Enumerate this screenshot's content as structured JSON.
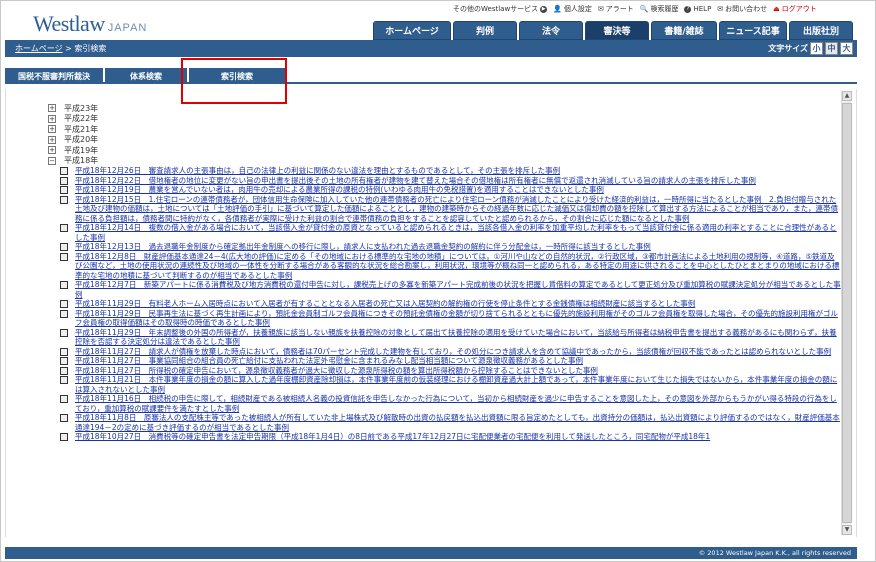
{
  "header": {
    "logo_main": "Westlaw",
    "logo_sub": "JAPAN",
    "util_links": [
      {
        "label": "その他のWestlawサービス",
        "icon": "circle-play-icon"
      },
      {
        "label": "個人設定",
        "icon": "person-icon"
      },
      {
        "label": "アラート",
        "icon": "alert-icon"
      },
      {
        "label": "検索履歴",
        "icon": "history-icon"
      },
      {
        "label": "HELP",
        "icon": "help-icon"
      },
      {
        "label": "お問い合わせ",
        "icon": "mail-icon"
      },
      {
        "label": "ログアウト",
        "icon": "logout-icon"
      }
    ],
    "nav": [
      "ホームページ",
      "判例",
      "法令",
      "審決等",
      "書籍/雑誌",
      "ニュース記事",
      "出版社別"
    ],
    "active_nav": "審決等"
  },
  "breadcrumb": {
    "home": "ホームページ",
    "sep": ">",
    "current": "索引検索"
  },
  "font_size": {
    "label": "文字サイズ",
    "options": [
      "小",
      "中",
      "大"
    ],
    "selected": "中"
  },
  "subtabs": [
    "国税不服審判所裁決",
    "体系検索",
    "索引検索"
  ],
  "years": [
    "平成23年",
    "平成22年",
    "平成21年",
    "平成20年",
    "平成19年",
    "平成18年"
  ],
  "expanded_year": "平成18年",
  "entries": [
    "平成18年12月26日　審査請求人の主張事由は，自己の法律上の利益に関係のない違法を理由とするものであるとして，その主張を排斥した事例",
    "平成18年12月22日　借地権者の地位に変更がない旨の申出書を提出後その土地の所有権者が建物を建て替えた場合その借地権は所有権者に無償で返還され消滅している旨の請求人の主張を排斥した事例",
    "平成18年12月19日　農業を営んでいない者は，肉用牛の売却による農業所得の課税の特例(いわゆる肉用牛の免税措置)を適用することはできないとした事例",
    "平成18年12月15日　1.住宅ローンの連帯債務者が，団体信用生命保険に加入していた他の連帯債務者の死亡により住宅ローン債務が消滅したことにより受けた経済的利益は，一時所得に当たるとした事例　2.負担付贈与された土地及び建物の価額は，土地については「土地評価の手引」に基づいて算定した価額によることとし，建物の建築時からその経過年数に応じた減価又は償却費の額を控除して算出する方法によることが相当であり，また，連帯債務に係る負担額は，債務者間に特約がなく，各債務者が実際に受けた利益の割合で連帯債務の負担をすることを認容していたと認められるから，その割合に応じた額になるとした事例",
    "平成18年12月14日　複数の借入金がある場合において，当該借入金が貸付金の原資となっていると認められるときは，当該各借入金の利率を加重平均した利率をもって当該貸付金に係る適用の利率とすることに合理性があるとした事例",
    "平成18年12月13日　過去退職年金制度から確定拠出年金制度への移行に際し，請求人に支払われた過去退職金契約の解約に伴う分配金は，一時所得に該当するとした事例",
    "平成18年12月8日　財産評価基本通達24－4(広大地の評価)に定める「その地域における標準的な宅地の地積」については，①河川や山などの自然的状況，②行政区域，③都市計画法による土地利用の規制等，④道路，⑤鉄道及び公園など，土地の使用状況の連続性及び地域の一体性を分断する場合がある客観的な状況を総合勘案し，利用状況，環境等が概ね同一と認められる，ある特定の用途に供されることを中心としたひとまとまりの地域における標準的な宅地の地積に基づいて判断するのが相当であるとした事例",
    "平成18年12月7日　新築アパートに係る消費税及び地方消費税の還付申告に対し，課税売上げの多寡を新築アパート完成前後の状況を把握し賃借料の算定であるとして更正処分及び重加算税の賦課決定処分が相当であるとした事例",
    "平成18年11月29日　有料老人ホーム入居時点において入居者が有することとなる入居者の死亡又は入居契約の解約権の行使を停止条件とする金銭債権は相続財産に該当するとした事例",
    "平成18年11月29日　民事再生法に基づく再生計画により，預託金会員制ゴルフ会員権につきその預託金債権の金額が切り捨てられるとともに優先的施設利用権がそのゴルフ会員権を取得した場合，その優先的施設利用権がゴルフ会員権の取得価額はその取得時の時価であるとした事例",
    "平成18年11月29日　年末調整後の外国の所得者が，扶養親族に該当しない親族を扶養控除の対象として届出て扶養控除の適用を受けていた場合において，当該給与所得者は納税申告書を提出する義務があるにも関わらず，扶養控除を否認する決定処分は違法であるとした事例",
    "平成18年11月27日　請求人が債権を放棄した時点において，債務者は70パーセント完成した建物を有しており，その処分につき請求人を含めて協議中であったから，当該債権が回収不能であったとは認められないとした事例",
    "平成18年11月27日　事業協同組合の組合員の死亡給付に支払われた法定外弔慰金に含まれるみなし配当相当額について源泉徴収義務があるとした事例",
    "平成18年11月27日　所得税の確定申告において，源泉徴収義務者が過大に徴収した源泉所得税の額を算出所得税額から控除することはできないとした事例",
    "平成18年11月21日　本件事業年度の損金の額に算入した過年度棚卸資産除却損は，本件事業年度前の仮装経理における棚卸資産過大計上額であって，本件事業年度において生じた損失ではないから，本件事業年度の損金の額には算入されないとした事例",
    "平成18年11月16日　相続税の申告に際して，相続財産である被相続人名義の投資信託を申告しなかった行為について，当初から相続財産を過少に申告することを意図した上，その意図を外部からもうかがい得る特段の行為をしており，重加算税の賦課要件を満たすとした事例",
    "平成18年11月8日　原審法人の支配株主等であった被相続人が所有していた非上場株式及び解散時の出資の払戻額を払込出資額に限る旨定めたとしても，出資持分の価額は，払込出資額により評価するのではなく，財産評価基本通達194－2の定めに基づき評価するのが相当であるとした事例",
    "平成18年10月27日　消費税等の確定申告書を法定申告期限（平成18年1月4日）の8日前である平成17年12月27日に宅配便業者の宅配便を利用して発送したところ，同宅配物が平成18年1"
  ],
  "footer": "© 2012 Westlaw Japan K.K., all rights reserved",
  "colors": {
    "nav_bg": "#2f5d8e",
    "link": "#1a33a8",
    "highlight_border": "#e00000"
  }
}
